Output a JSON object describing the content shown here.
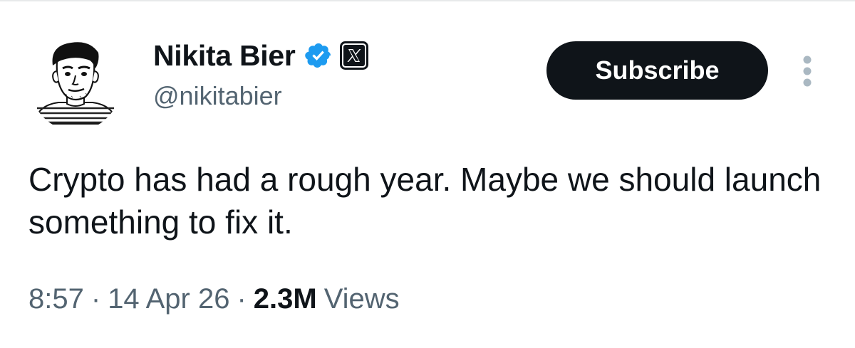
{
  "tweet": {
    "author": {
      "display_name": "Nikita Bier",
      "handle": "@nikitabier",
      "verified_icon": "verified-badge-icon",
      "affiliation_icon": "x-logo-icon"
    },
    "subscribe_label": "Subscribe",
    "more_icon": "more-vertical-icon",
    "text": "Crypto has had a rough year. Maybe we should launch something to fix it.",
    "time": "8:57",
    "date": "14 Apr 26",
    "separator": "·",
    "views_count": "2.3M",
    "views_label": "Views"
  },
  "colors": {
    "text_primary": "#0f1419",
    "text_secondary": "#536471",
    "verified_blue": "#1d9bf0",
    "button_bg": "#0f1419",
    "divider": "#e7e9ea"
  }
}
